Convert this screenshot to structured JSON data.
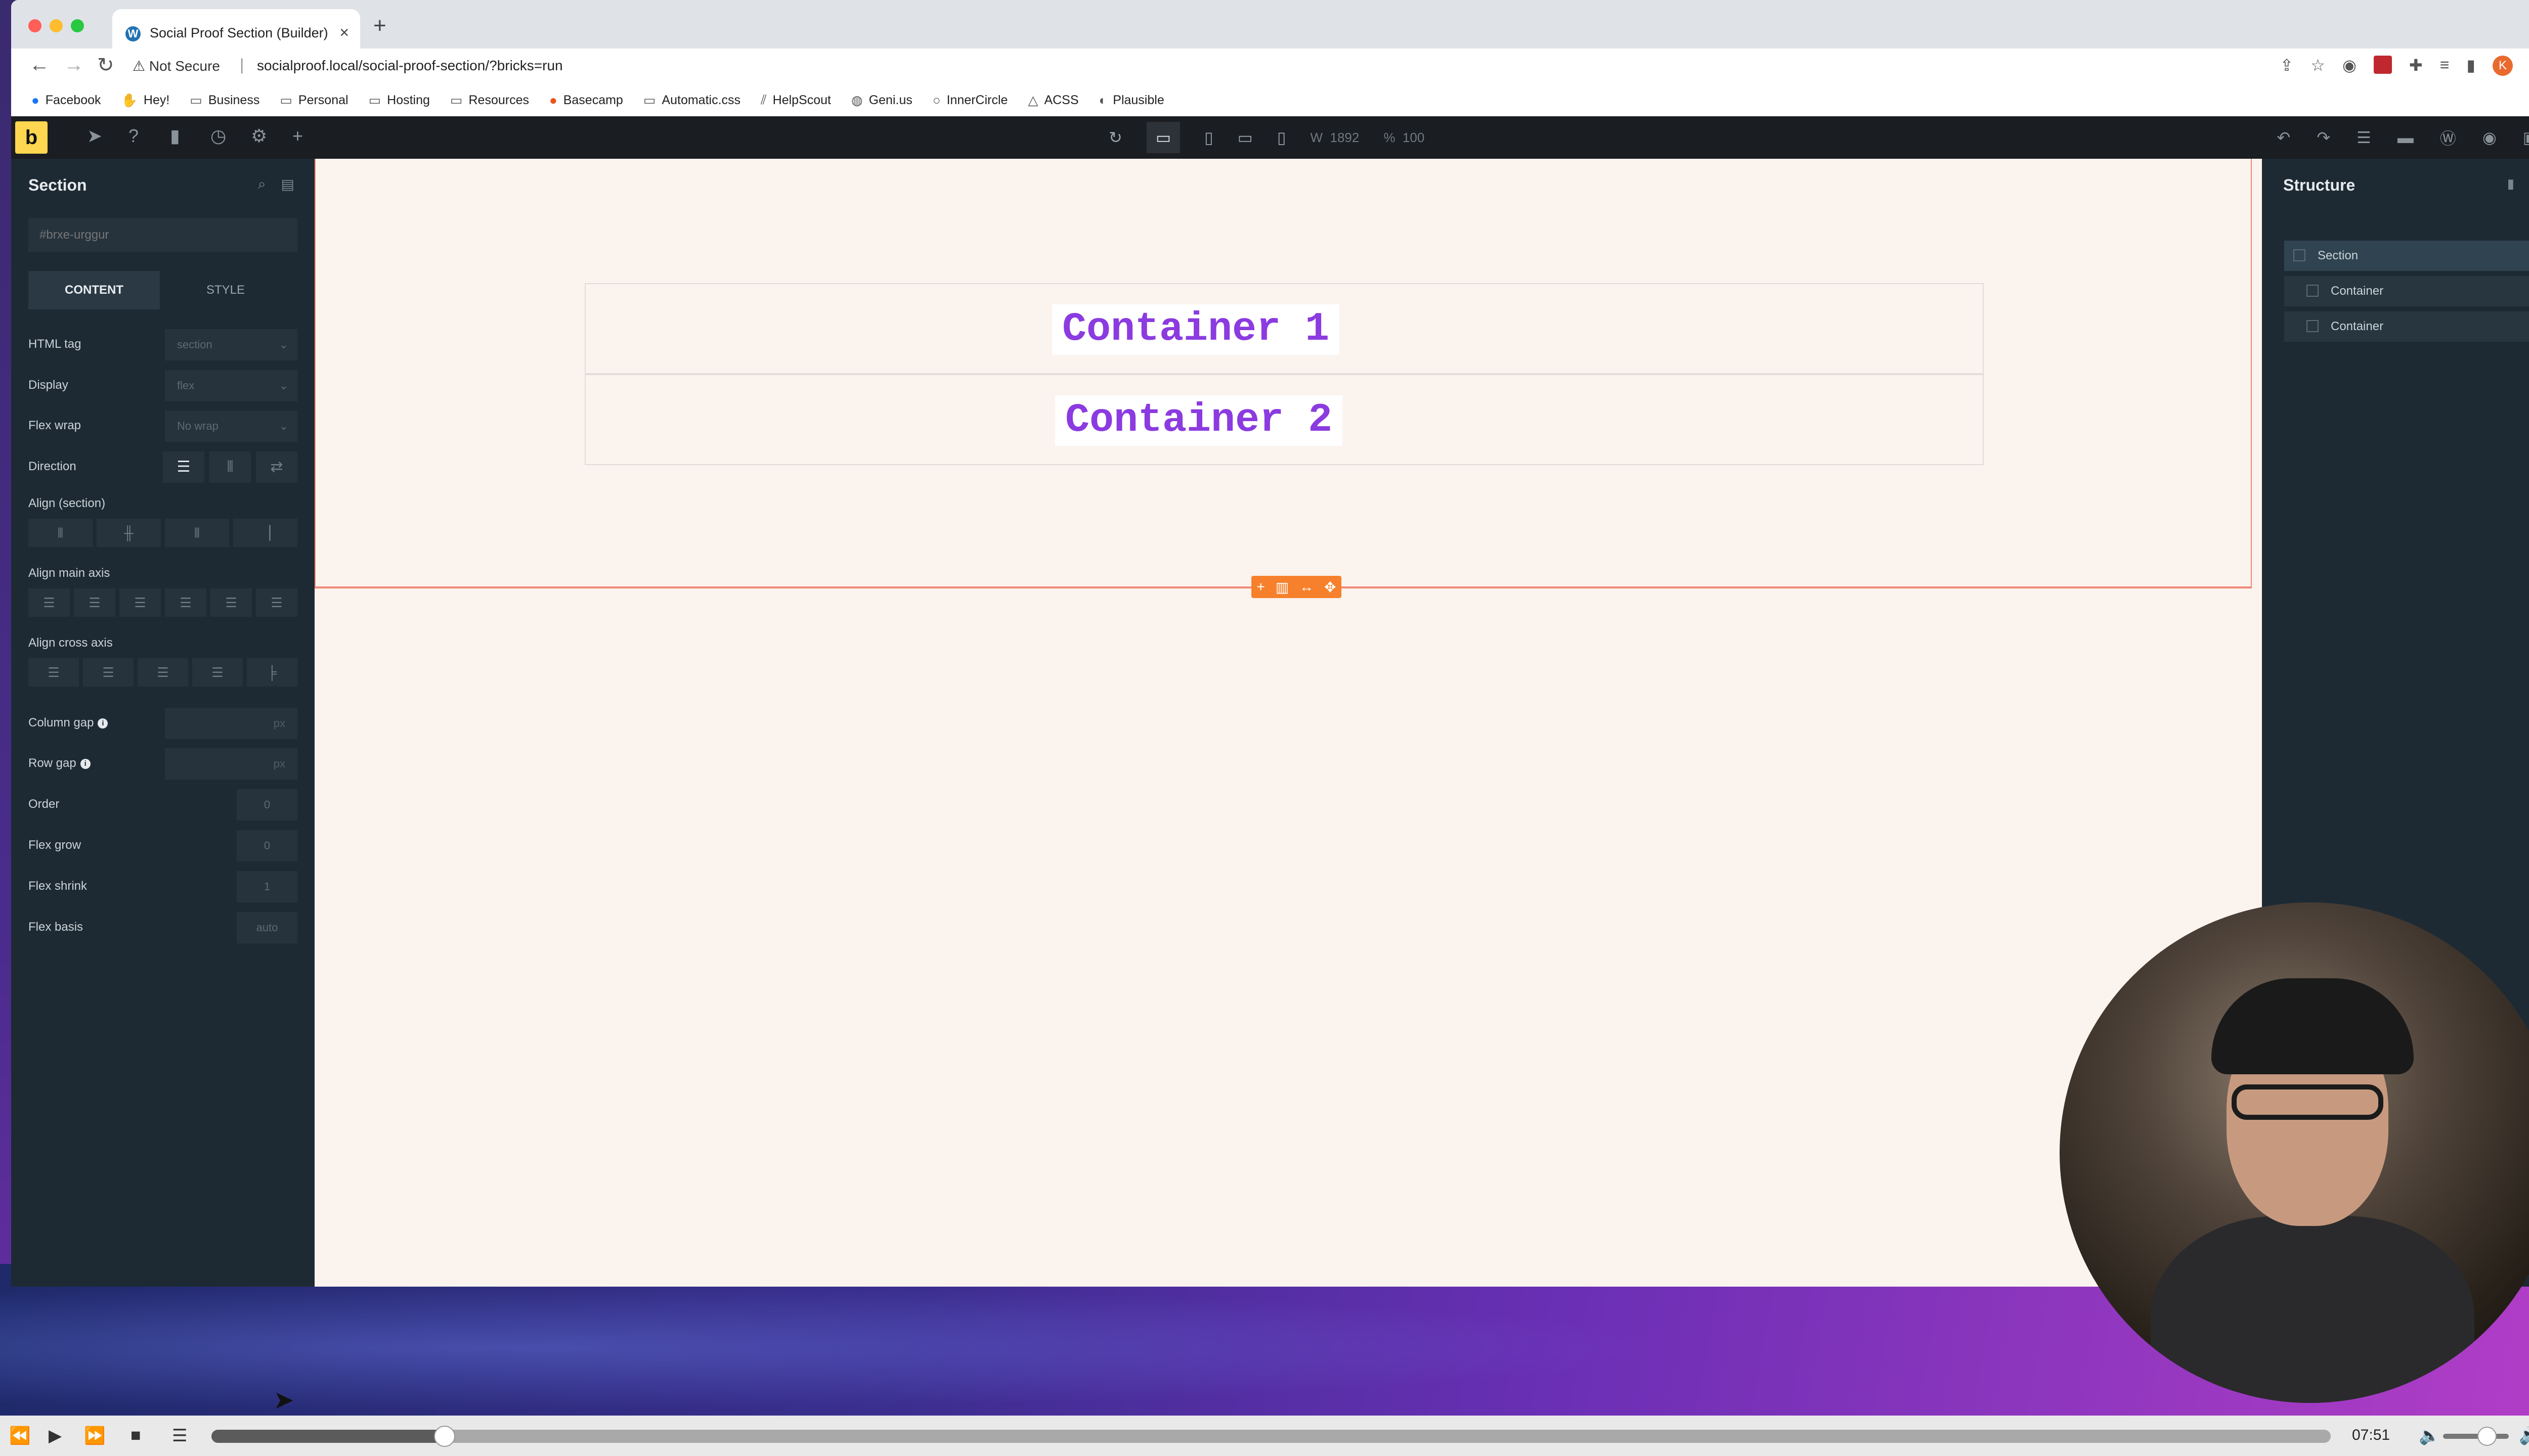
{
  "browser": {
    "tab_title": "Social Proof Section (Builder)",
    "url_security": "Not Secure",
    "url": "socialproof.local/social-proof-section/?bricks=run",
    "profile_initial": "K",
    "bookmarks": [
      "Facebook",
      "Hey!",
      "Business",
      "Personal",
      "Hosting",
      "Resources",
      "Basecamp",
      "Automatic.css",
      "HelpScout",
      "Geni.us",
      "InnerCircle",
      "ACSS",
      "Plausible"
    ]
  },
  "toolbar": {
    "logo": "b",
    "width_label": "W",
    "width_value": "1892",
    "zoom_label": "%",
    "zoom_value": "100"
  },
  "left_panel": {
    "title": "Section",
    "id_placeholder": "#brxe-urggur",
    "tabs": [
      "CONTENT",
      "STYLE"
    ],
    "fields": {
      "html_tag": {
        "label": "HTML tag",
        "value": "section"
      },
      "display": {
        "label": "Display",
        "value": "flex"
      },
      "flex_wrap": {
        "label": "Flex wrap",
        "value": "No wrap"
      },
      "direction": {
        "label": "Direction"
      },
      "align_section": {
        "label": "Align (section)"
      },
      "align_main": {
        "label": "Align main axis"
      },
      "align_cross": {
        "label": "Align cross axis"
      },
      "column_gap": {
        "label": "Column gap",
        "unit": "px"
      },
      "row_gap": {
        "label": "Row gap",
        "unit": "px"
      },
      "order": {
        "label": "Order",
        "value": "0"
      },
      "flex_grow": {
        "label": "Flex grow",
        "value": "0"
      },
      "flex_shrink": {
        "label": "Flex shrink",
        "value": "1"
      },
      "flex_basis": {
        "label": "Flex basis",
        "value": "auto"
      }
    }
  },
  "canvas": {
    "container1_heading": "Container 1",
    "container2_heading": "Container 2"
  },
  "structure": {
    "title": "Structure",
    "items": [
      {
        "label": "Section",
        "level": 0
      },
      {
        "label": "Container",
        "level": 1
      },
      {
        "label": "Container",
        "level": 1
      }
    ]
  },
  "player": {
    "time": "07:51",
    "progress": 0.11
  }
}
